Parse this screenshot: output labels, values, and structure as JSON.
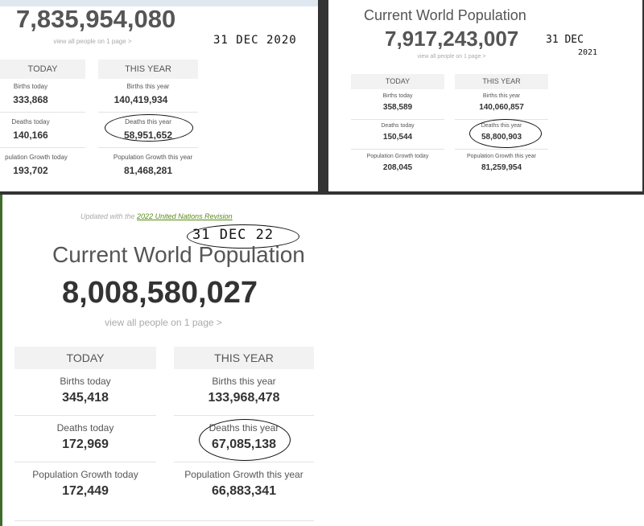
{
  "snapshot_2020": {
    "population": "7,835,954,080",
    "view_all": "view all people on 1 page >",
    "handwritten_date": "31 DEC 2020",
    "today_header": "TODAY",
    "year_header": "THIS YEAR",
    "births_today_label": "Births today",
    "births_today": "333,868",
    "births_year_label": "Births this year",
    "births_year": "140,419,934",
    "deaths_today_label": "Deaths today",
    "deaths_today": "140,166",
    "deaths_year_label": "Deaths this year",
    "deaths_year": "58,951,652",
    "growth_today_label": "pulation Growth today",
    "growth_today": "193,702",
    "growth_year_label": "Population Growth this year",
    "growth_year": "81,468,281"
  },
  "snapshot_2021": {
    "title": "Current World Population",
    "population": "7,917,243,007",
    "view_all": "view all people on 1 page >",
    "handwritten_date_line1": "31 DEC",
    "handwritten_date_line2": "2021",
    "today_header": "TODAY",
    "year_header": "THIS YEAR",
    "births_today_label": "Births today",
    "births_today": "358,589",
    "births_year_label": "Births this year",
    "births_year": "140,060,857",
    "deaths_today_label": "Deaths today",
    "deaths_today": "150,544",
    "deaths_year_label": "Deaths this year",
    "deaths_year": "58,800,903",
    "growth_today_label": "Population Growth today",
    "growth_today": "208,045",
    "growth_year_label": "Population Growth this year",
    "growth_year": "81,259,954"
  },
  "snapshot_2022": {
    "updated_prefix": "Updated with the ",
    "updated_link": "2022 United Nations Revision",
    "handwritten_date": "31 DEC 22",
    "title": "Current World Population",
    "population": "8,008,580,027",
    "view_all": "view all people on 1 page >",
    "today_header": "TODAY",
    "year_header": "THIS YEAR",
    "births_today_label": "Births today",
    "births_today": "345,418",
    "births_year_label": "Births this year",
    "births_year": "133,968,478",
    "deaths_today_label": "Deaths today",
    "deaths_today": "172,969",
    "deaths_year_label": "Deaths this year",
    "deaths_year": "67,085,138",
    "growth_today_label": "Population Growth today",
    "growth_today": "172,449",
    "growth_year_label": "Population Growth this year",
    "growth_year": "66,883,341"
  },
  "colors": {
    "frame_dark": "#333333",
    "side_green": "#3f6b2b",
    "link_green": "#5a8a1a",
    "header_gray": "#f2f2f2",
    "text_gray": "#555555",
    "number_dark": "#333333"
  }
}
